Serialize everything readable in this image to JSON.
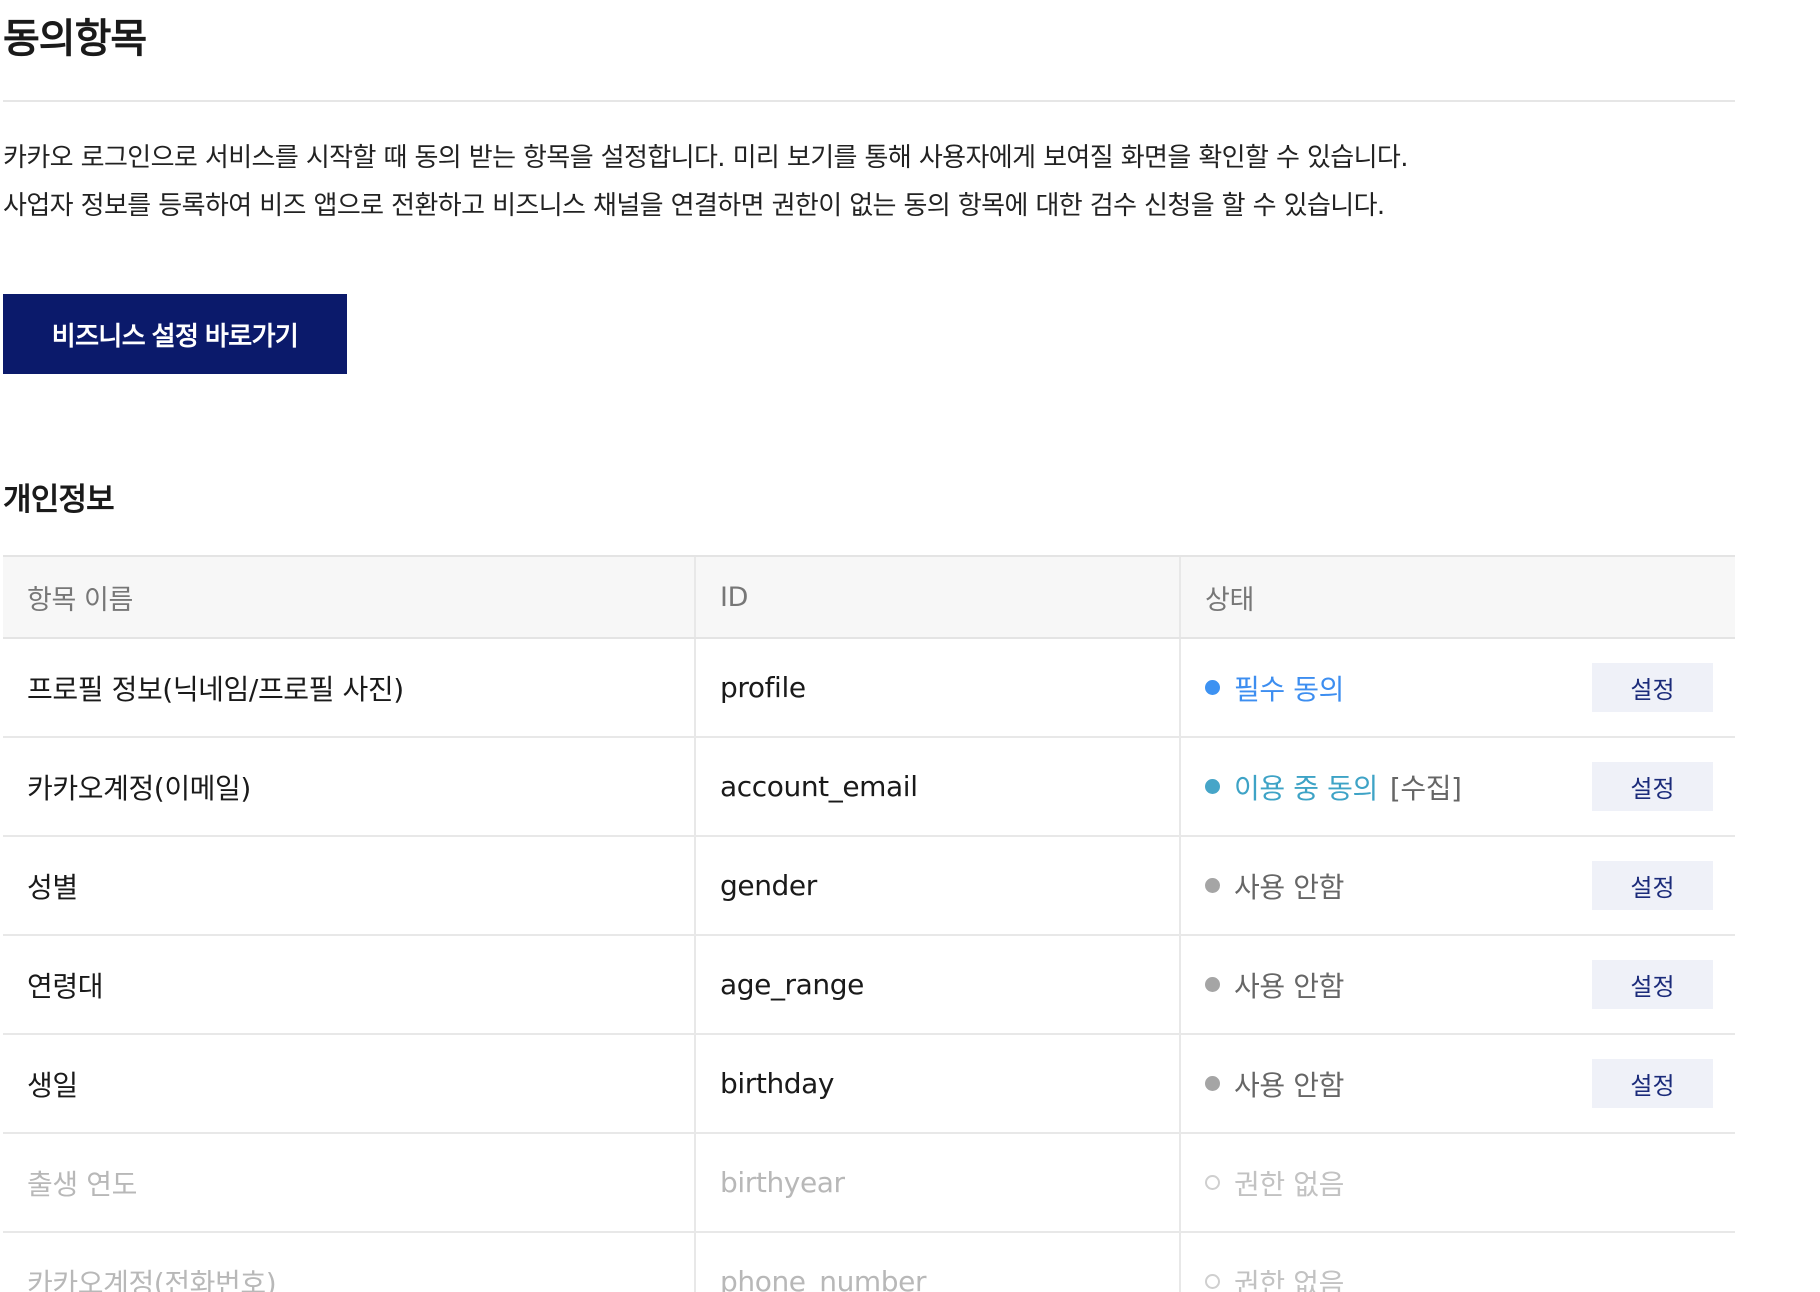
{
  "page": {
    "title": "동의항목",
    "description": [
      "카카오 로그인으로 서비스를 시작할 때 동의 받는 항목을 설정합니다. 미리 보기를 통해 사용자에게 보여질 화면을 확인할 수 있습니다.",
      "사업자 정보를 등록하여 비즈 앱으로 전환하고 비즈니스 채널을 연결하면 권한이 없는 동의 항목에 대한 검수 신청을 할 수 있습니다."
    ],
    "business_button_label": "비즈니스 설정 바로가기"
  },
  "section": {
    "title": "개인정보"
  },
  "table": {
    "headers": [
      "항목 이름",
      "ID",
      "상태"
    ],
    "rows": [
      {
        "name": "프로필 정보(닉네임/프로필 사진)",
        "id": "profile",
        "status": "필수 동의",
        "extra": "",
        "action": "설정"
      },
      {
        "name": "카카오계정(이메일)",
        "id": "account_email",
        "status": "이용 중 동의",
        "extra": "[수집]",
        "action": "설정"
      },
      {
        "name": "성별",
        "id": "gender",
        "status": "사용 안함",
        "extra": "",
        "action": "설정"
      },
      {
        "name": "연령대",
        "id": "age_range",
        "status": "사용 안함",
        "extra": "",
        "action": "설정"
      },
      {
        "name": "생일",
        "id": "birthday",
        "status": "사용 안함",
        "extra": "",
        "action": "설정"
      },
      {
        "name": "출생 연도",
        "id": "birthyear",
        "status": "권한 없음",
        "extra": "",
        "action": ""
      },
      {
        "name": "카카오계정(전화번호)",
        "id": "phone_number",
        "status": "권한 없음",
        "extra": "",
        "action": ""
      }
    ]
  },
  "colors": {
    "primary_button": "#0b1a6b",
    "status_required": "#3d92f2",
    "status_in_use": "#46a5c8",
    "status_unused": "#a5a5a5",
    "set_button_bg": "#eff1f8",
    "set_button_text": "#1b2b7a"
  }
}
